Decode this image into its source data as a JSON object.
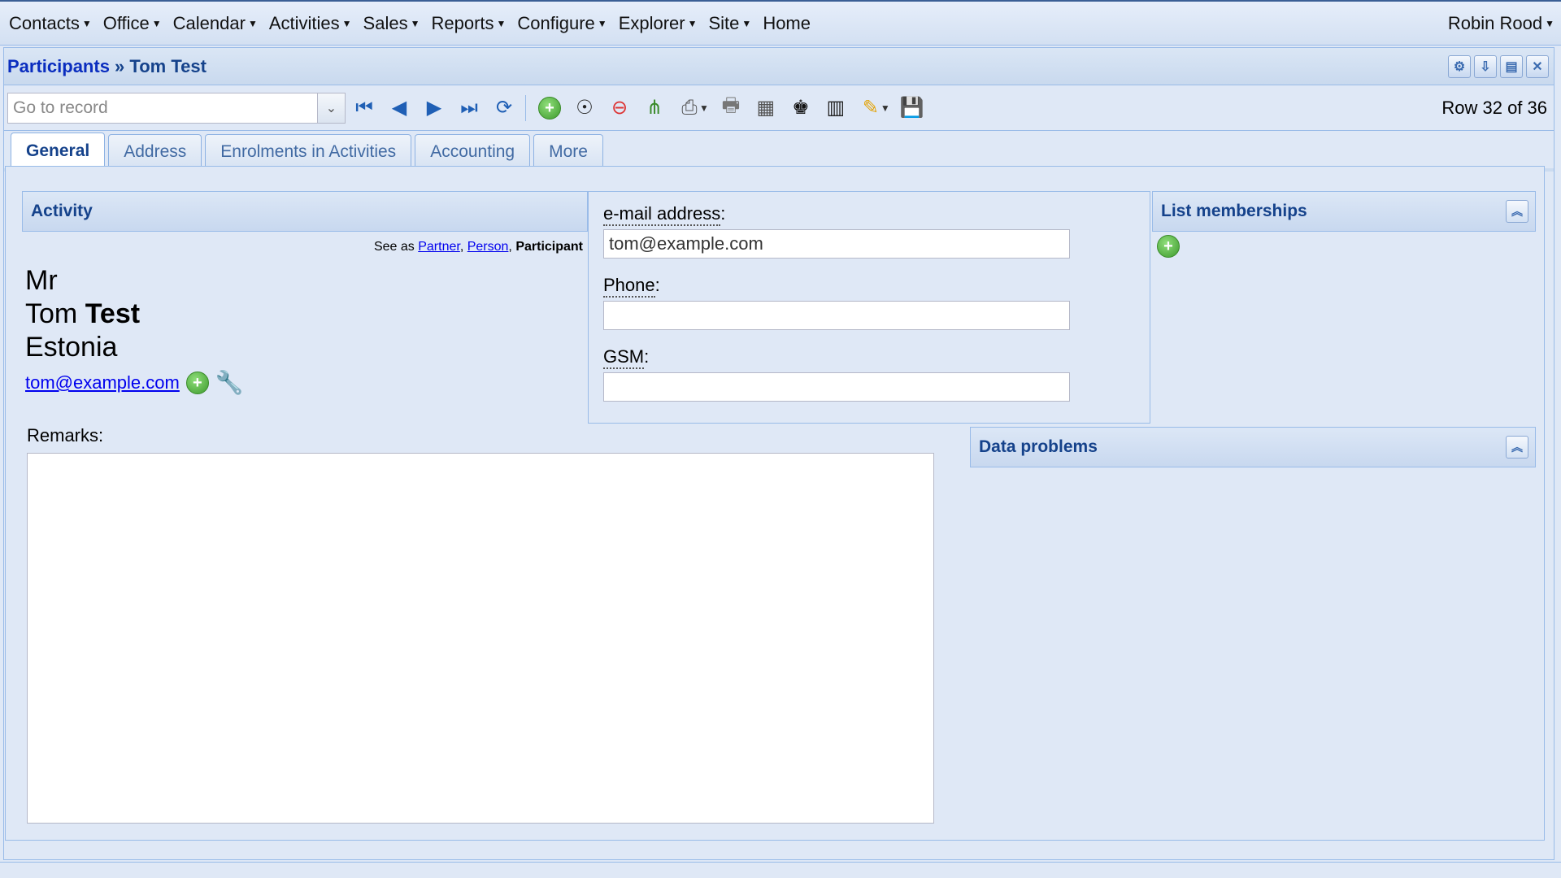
{
  "menubar": {
    "items": [
      "Contacts",
      "Office",
      "Calendar",
      "Activities",
      "Sales",
      "Reports",
      "Configure",
      "Explorer",
      "Site"
    ],
    "home": "Home",
    "user": "Robin Rood"
  },
  "window": {
    "breadcrumb_link": "Participants",
    "breadcrumb_sep": " » ",
    "breadcrumb_current": "Tom Test"
  },
  "toolbar": {
    "goto_placeholder": "Go to record",
    "row_info": "Row 32 of 36"
  },
  "tabs": [
    "General",
    "Address",
    "Enrolments in Activities",
    "Accounting",
    "More"
  ],
  "activity": {
    "title": "Activity",
    "see_as_prefix": "See as ",
    "see_as_partner": "Partner",
    "see_as_person": "Person",
    "see_as_current": "Participant",
    "salutation": "Mr",
    "first_name": "Tom",
    "last_name": "Test",
    "country": "Estonia",
    "email": "tom@example.com"
  },
  "fields": {
    "email_label": "e-mail address",
    "email_value": "tom@example.com",
    "phone_label": "Phone",
    "phone_value": "",
    "gsm_label": "GSM",
    "gsm_value": ""
  },
  "lists": {
    "title": "List memberships"
  },
  "remarks": {
    "label": "Remarks:"
  },
  "problems": {
    "title": "Data problems"
  }
}
